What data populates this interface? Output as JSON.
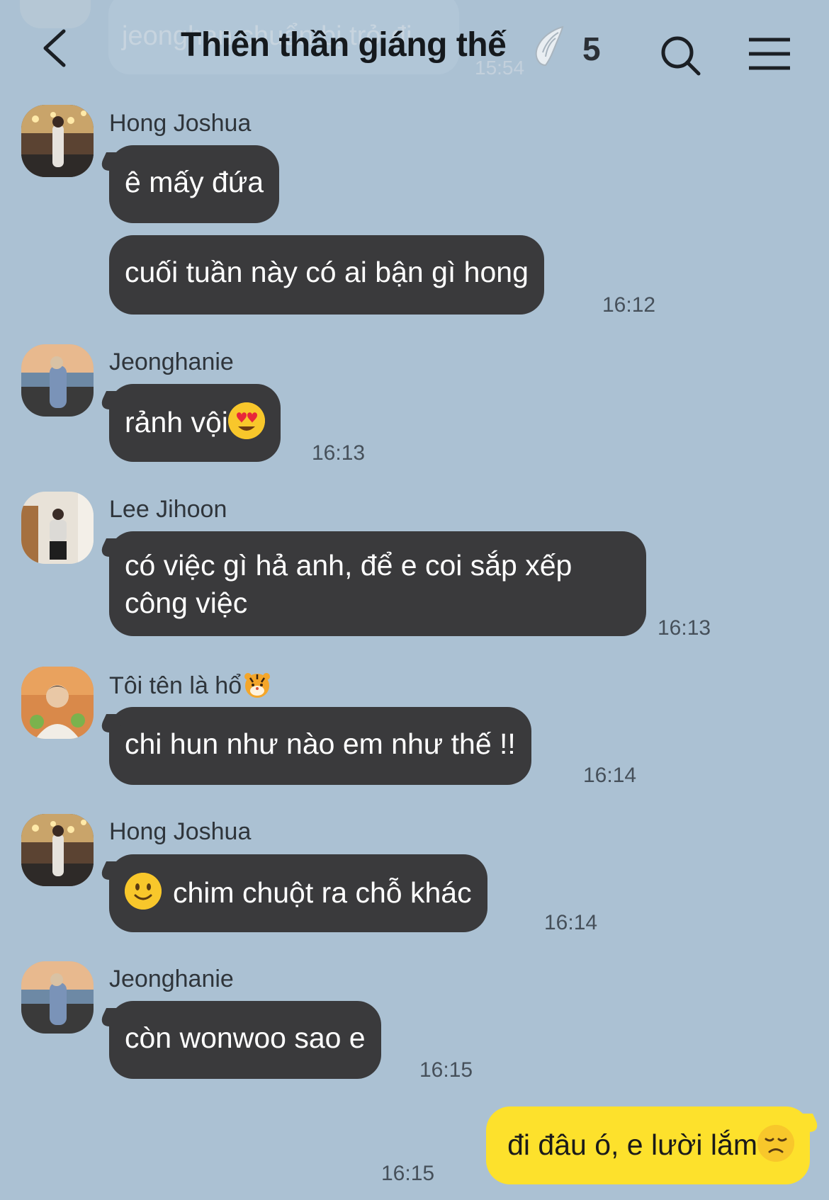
{
  "chat": {
    "title": "Thiên thần giáng thế",
    "member_count": "5",
    "ghost_preview": "jeonghan chuẩn bị trở đi",
    "ghost_time": "15:54"
  },
  "messages": [
    {
      "sender": "Hong Joshua",
      "text": "ê mấy đứa"
    },
    {
      "text": "cuối tuần này có ai bận gì hong",
      "time": "16:12"
    },
    {
      "sender": "Jeonghanie",
      "text": "rảnh vội",
      "time": "16:13"
    },
    {
      "sender": "Lee Jihoon",
      "text": "có việc gì hả anh, để e coi sắp xếp công việc",
      "time": "16:13"
    },
    {
      "sender": "Tôi tên là hổ",
      "text": "chi hun như nào em như thế !!",
      "time": "16:14"
    },
    {
      "sender": "Hong Joshua",
      "text": "chim chuột ra chỗ khác",
      "time": "16:14"
    },
    {
      "sender": "Jeonghanie",
      "text": "còn wonwoo sao e",
      "time": "16:15"
    },
    {
      "text": "đi đâu ó, e lười lắm",
      "time": "16:15",
      "mine": true
    }
  ],
  "icons": {
    "back": "chevron-left-icon",
    "search": "search-icon",
    "menu": "hamburger-menu-icon",
    "title_badge": "angel-wing-icon"
  },
  "colors": {
    "background": "#abc1d3",
    "bubble_other": "#3a3a3c",
    "bubble_mine": "#fde12c"
  }
}
